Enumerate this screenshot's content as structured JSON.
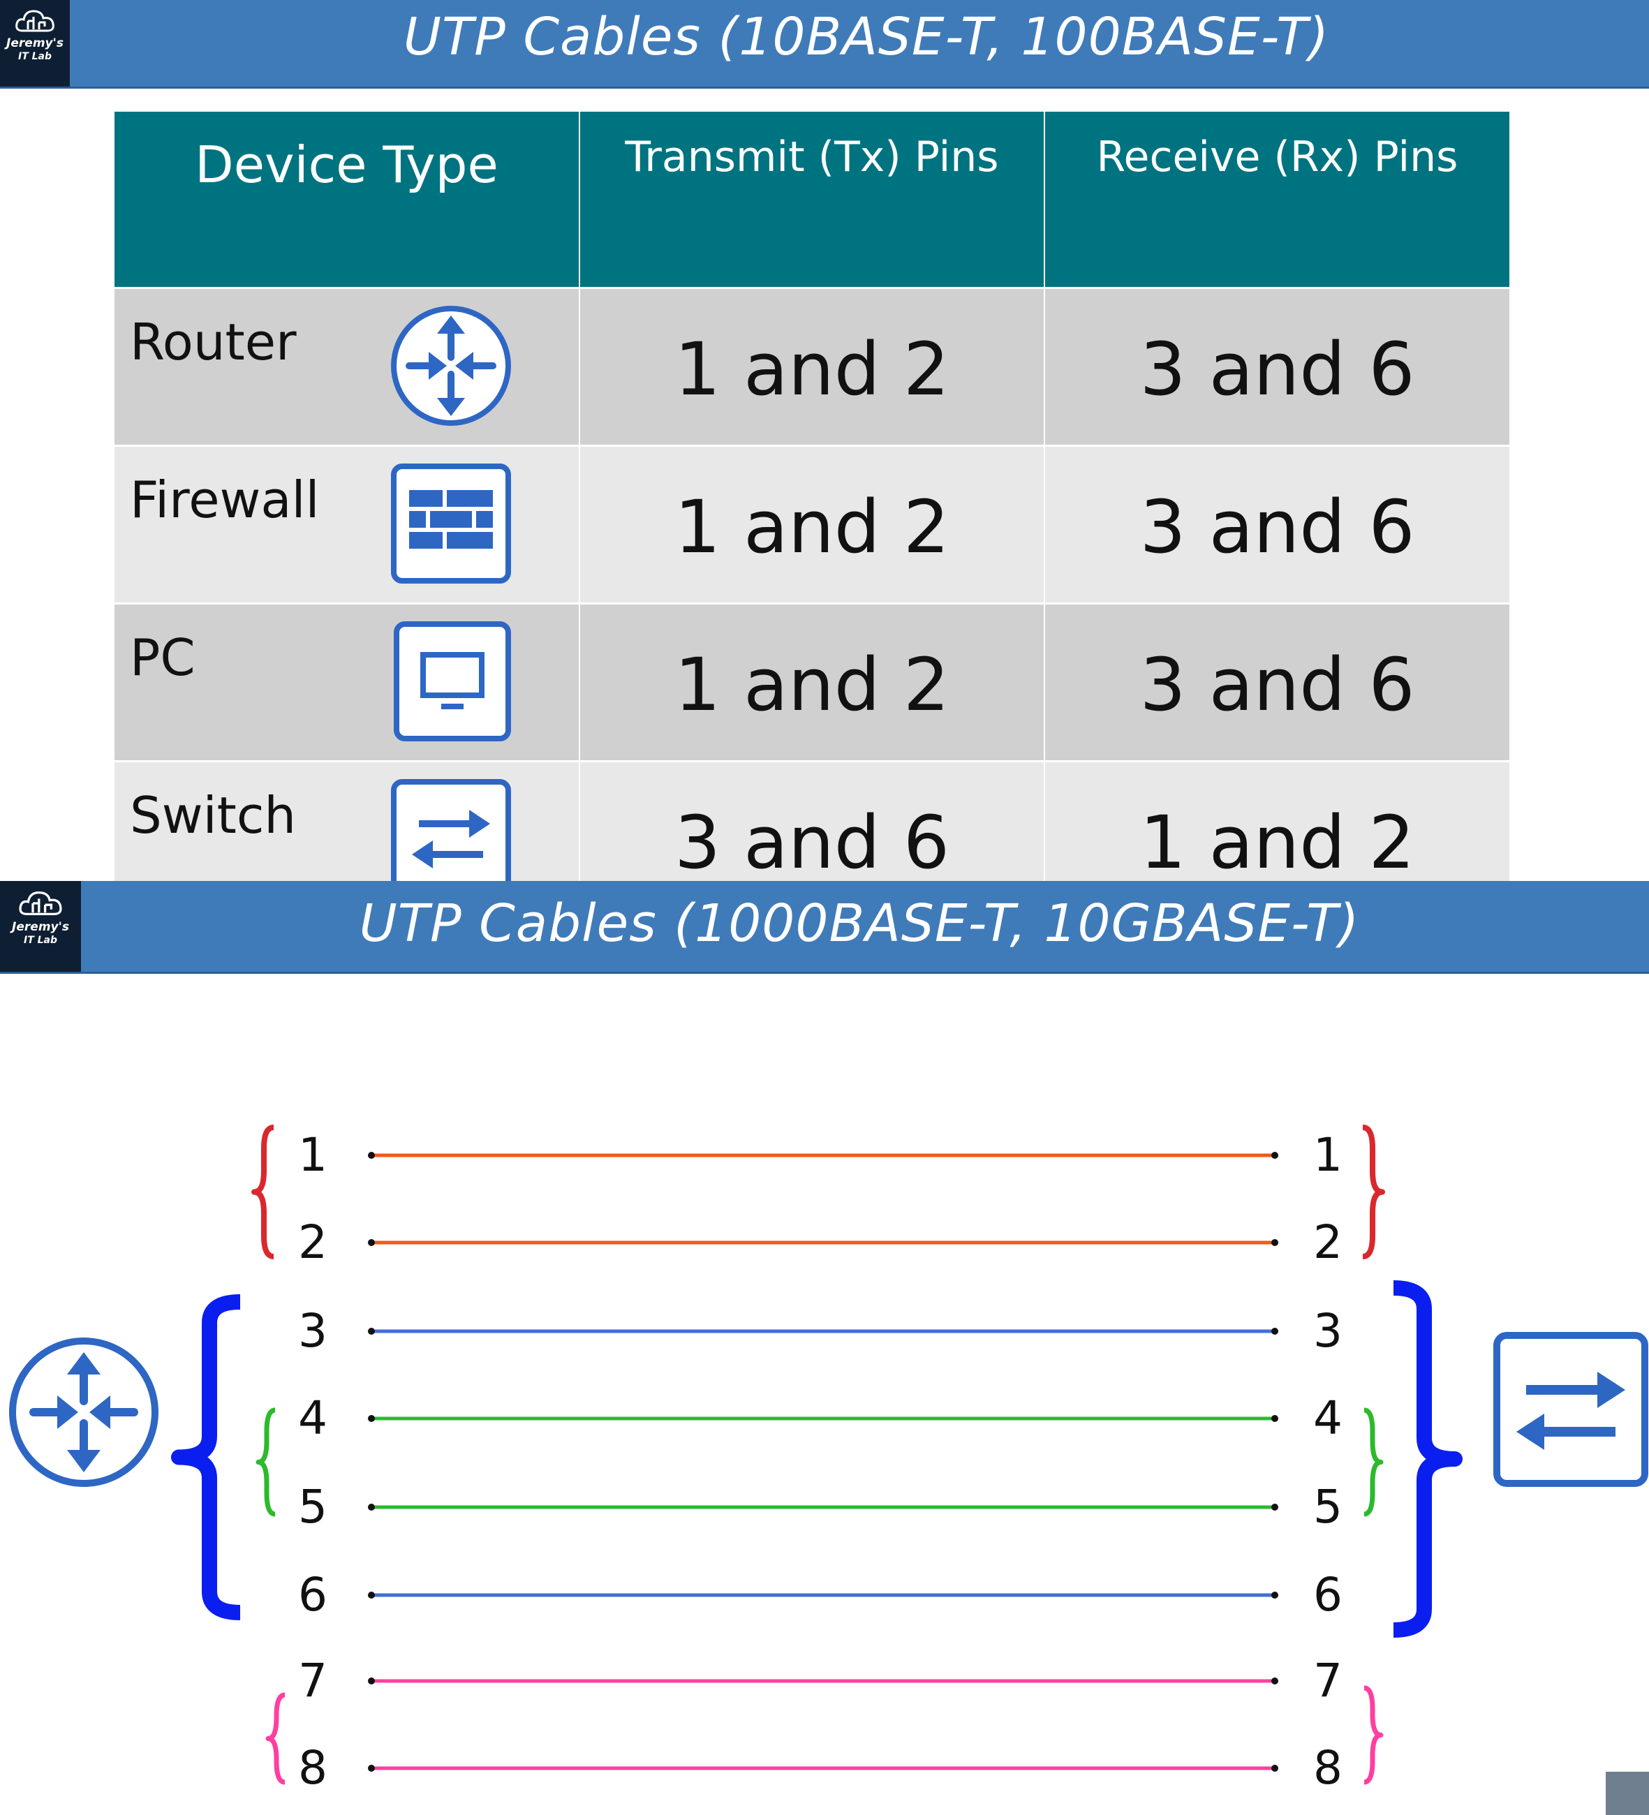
{
  "slides": [
    {
      "title": "UTP Cables (10BASE-T, 100BASE-T)",
      "logo": {
        "line1": "Jeremy's",
        "line2": "IT Lab"
      }
    },
    {
      "title": "UTP Cables (1000BASE-T, 10GBASE-T)",
      "logo": {
        "line1": "Jeremy's",
        "line2": "IT Lab"
      }
    }
  ],
  "table": {
    "headers": [
      "Device Type",
      "Transmit (Tx) Pins",
      "Receive (Rx) Pins"
    ],
    "rows": [
      {
        "device": "Router",
        "icon": "router-icon",
        "tx": "1 and 2",
        "rx": "3 and 6"
      },
      {
        "device": "Firewall",
        "icon": "firewall-icon",
        "tx": "1 and 2",
        "rx": "3 and 6"
      },
      {
        "device": "PC",
        "icon": "pc-icon",
        "tx": "1 and 2",
        "rx": "3 and 6"
      },
      {
        "device": "Switch",
        "icon": "switch-icon",
        "tx": "3 and 6",
        "rx": "1 and 2"
      }
    ]
  },
  "wiring": {
    "left_device": "router-icon",
    "right_device": "switch-icon",
    "pairs": [
      {
        "pins": [
          "1",
          "2"
        ],
        "color": "#f05a14",
        "bracket_color": "#d9282e"
      },
      {
        "pins": [
          "3",
          "6"
        ],
        "color": "#3f6fd8",
        "bracket_color": "#0a1ef0"
      },
      {
        "pins": [
          "4",
          "5"
        ],
        "color": "#2cba2c",
        "bracket_color": "#2cba2c"
      },
      {
        "pins": [
          "7",
          "8"
        ],
        "color": "#ff3fa0",
        "bracket_color": "#ff3fa0"
      }
    ],
    "wires": [
      {
        "pin": "1",
        "color": "#f05a14"
      },
      {
        "pin": "2",
        "color": "#f05a14"
      },
      {
        "pin": "3",
        "color": "#3f6fd8"
      },
      {
        "pin": "4",
        "color": "#2cba2c"
      },
      {
        "pin": "5",
        "color": "#2cba2c"
      },
      {
        "pin": "6",
        "color": "#3f6fd8"
      },
      {
        "pin": "7",
        "color": "#ff3fa0"
      },
      {
        "pin": "8",
        "color": "#ff3fa0"
      }
    ],
    "icon_color": "#2e66c4"
  }
}
